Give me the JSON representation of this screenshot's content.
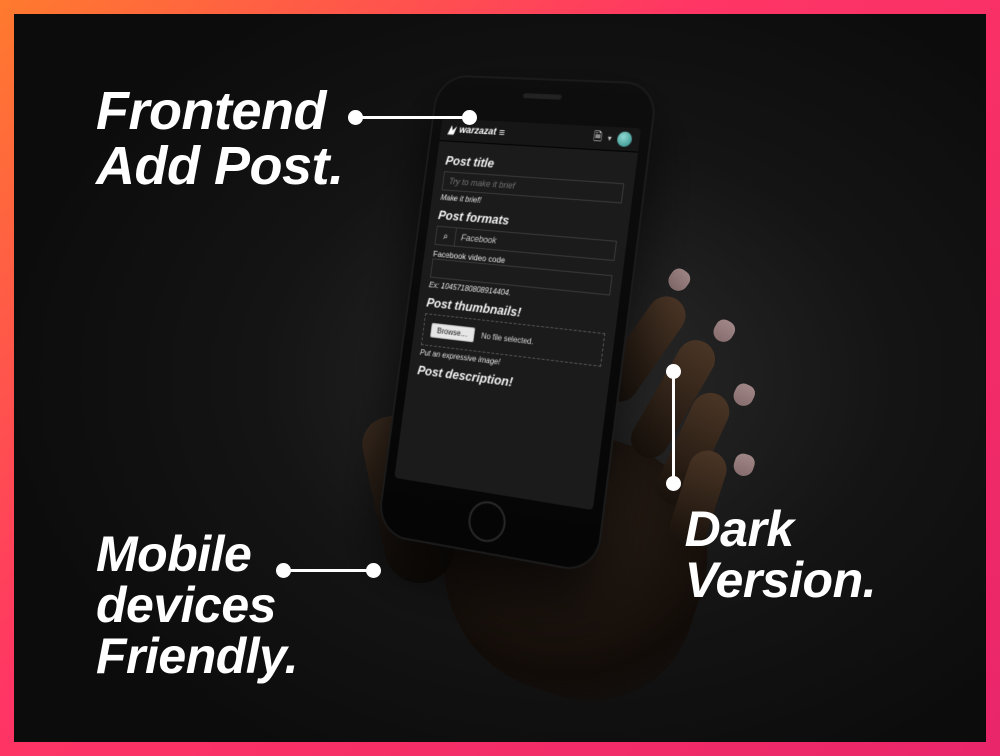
{
  "callouts": {
    "top_left_l1": "Frontend",
    "top_left_l2": "Add Post.",
    "bottom_left_l1": "Mobile",
    "bottom_left_l2": "devices",
    "bottom_left_l3": "Friendly.",
    "right_l1": "Dark",
    "right_l2": "Version."
  },
  "phone": {
    "brand": "warzazat",
    "menu": "≡",
    "doc_icon": "🗎",
    "caret": "▾",
    "form": {
      "title_label": "Post title",
      "title_placeholder": "Try to make it brief",
      "title_hint": "Make it brief!",
      "formats_label": "Post formats",
      "format_selected": "Facebook",
      "video_code_label": "Facebook video code",
      "video_code_hint": "Ex: 10457180808914404.",
      "thumb_label": "Post thumbnails!",
      "browse": "Browse…",
      "nofile": "No file selected.",
      "thumb_hint": "Put an expressive image!",
      "desc_label": "Post description!"
    }
  }
}
